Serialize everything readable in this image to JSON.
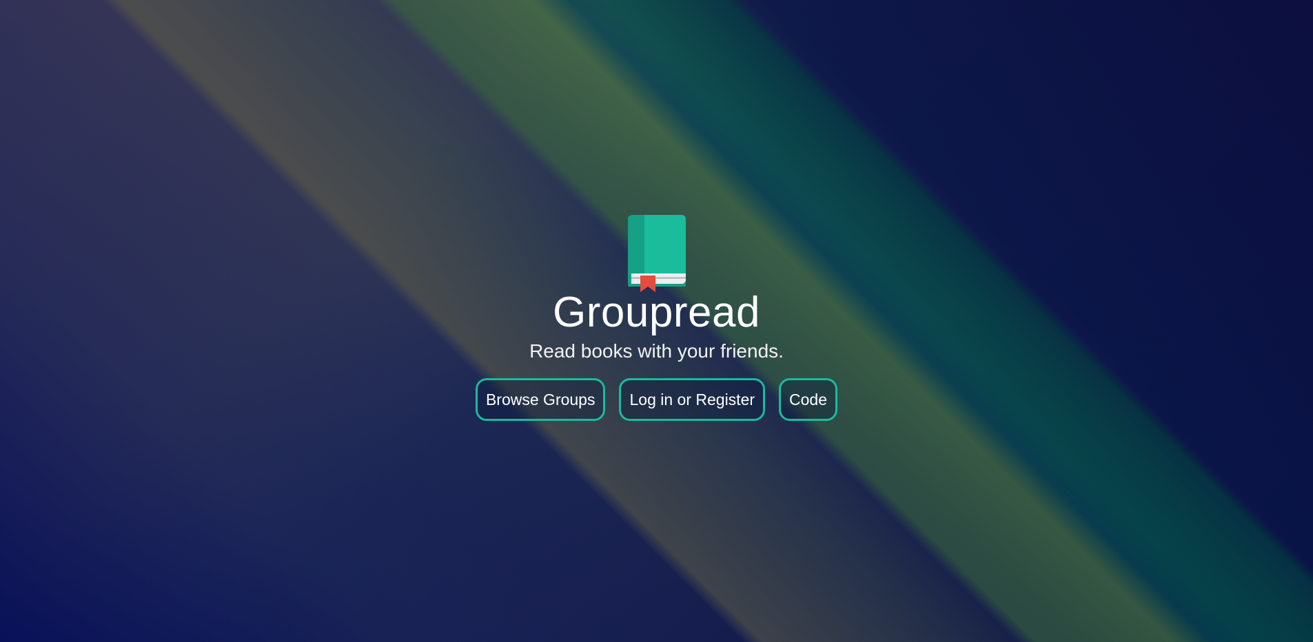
{
  "app": {
    "title": "Groupread",
    "tagline": "Read books with your friends."
  },
  "logo": {
    "icon": "book-icon",
    "cover_color": "#1abc9c",
    "spine_color": "#16a085",
    "bookmark_color": "#e74c3c"
  },
  "actions": {
    "browse_label": "Browse Groups",
    "login_label": "Log in or Register",
    "code_label": "Code",
    "border_color": "#1abc9c"
  }
}
